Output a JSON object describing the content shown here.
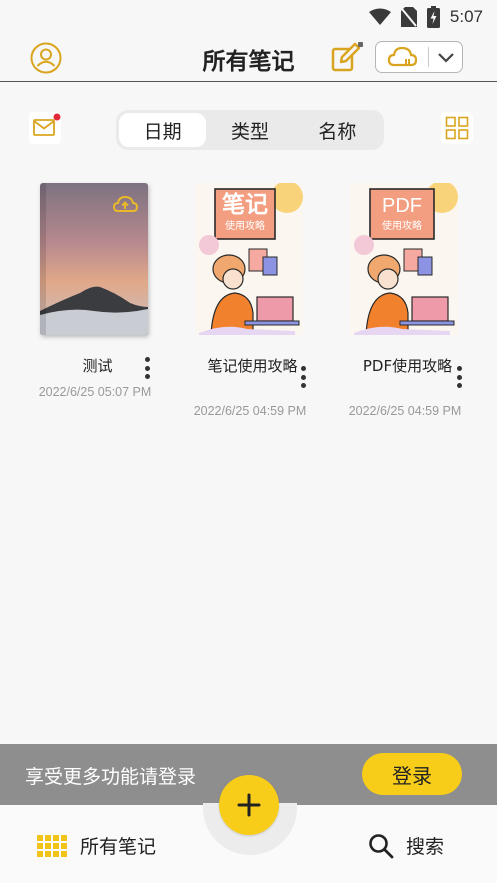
{
  "status_bar": {
    "time": "5:07"
  },
  "header": {
    "title": "所有笔记"
  },
  "tabs": [
    {
      "label": "日期",
      "active": true
    },
    {
      "label": "类型",
      "active": false
    },
    {
      "label": "名称",
      "active": false
    }
  ],
  "notes": [
    {
      "title": "测试",
      "date": "2022/6/25 05:07 PM",
      "cover": "landscape"
    },
    {
      "title": "笔记使用攻略",
      "date": "2022/6/25 04:59 PM",
      "cover": "guide",
      "cover_heading": "笔记",
      "cover_sub": "使用攻略"
    },
    {
      "title": "PDF使用攻略",
      "date": "2022/6/25 04:59 PM",
      "cover": "guide",
      "cover_heading": "PDF",
      "cover_sub": "使用攻略"
    }
  ],
  "login_banner": {
    "text": "享受更多功能请登录",
    "button": "登录"
  },
  "bottom_nav": {
    "all_notes": "所有笔记",
    "search": "搜索"
  },
  "colors": {
    "accent": "#f7cd1a",
    "banner": "#8e8e8e",
    "notify_dot": "#e02b3a",
    "icon_gold": "#d9a520"
  }
}
